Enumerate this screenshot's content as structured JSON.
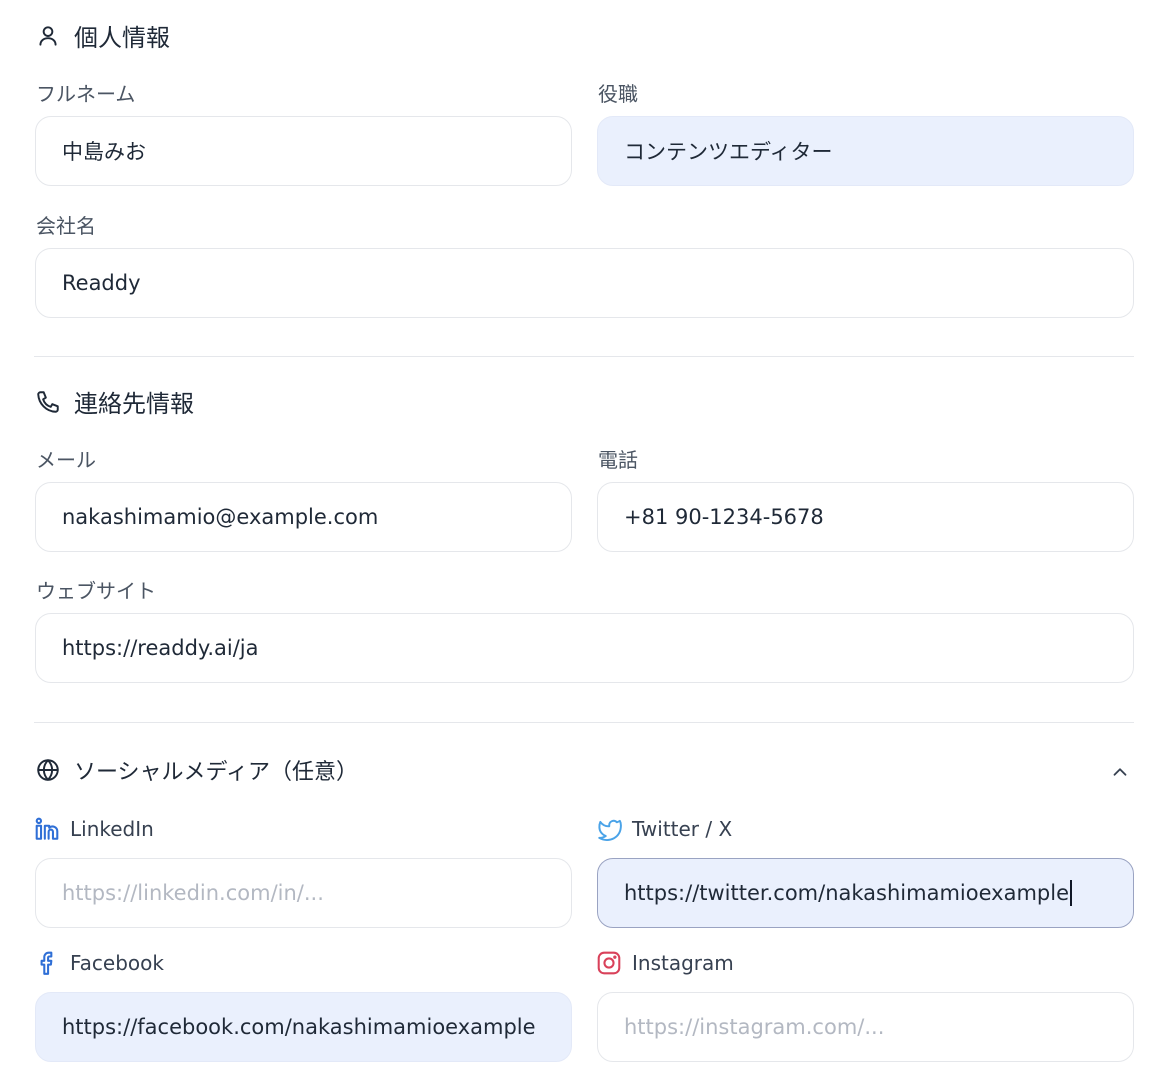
{
  "personal": {
    "title": "個人情報",
    "icon": "user-icon",
    "full_name": {
      "label": "フルネーム",
      "value": "中島みお"
    },
    "job_title": {
      "label": "役職",
      "value": "コンテンツエディター"
    },
    "company": {
      "label": "会社名",
      "value": "Readdy"
    }
  },
  "contact": {
    "title": "連絡先情報",
    "icon": "phone-icon",
    "email": {
      "label": "メール",
      "value": "nakashimamio@example.com"
    },
    "phone": {
      "label": "電話",
      "value": "+81 90-1234-5678"
    },
    "website": {
      "label": "ウェブサイト",
      "value": "https://readdy.ai/ja"
    }
  },
  "social": {
    "title": "ソーシャルメディア（任意）",
    "icon": "globe-icon",
    "collapse_icon": "chevron-up-icon",
    "linkedin": {
      "label": "LinkedIn",
      "placeholder": "https://linkedin.com/in/...",
      "value": "",
      "icon": "linkedin-icon",
      "color": "#2f6fd6"
    },
    "twitter": {
      "label": "Twitter / X",
      "value": "https://twitter.com/nakashimamioexample",
      "icon": "twitter-icon",
      "color": "#4aa3e8"
    },
    "facebook": {
      "label": "Facebook",
      "value": "https://facebook.com/nakashimamioexample",
      "icon": "facebook-icon",
      "color": "#2f6fd6"
    },
    "instagram": {
      "label": "Instagram",
      "placeholder": "https://instagram.com/...",
      "value": "",
      "icon": "instagram-icon",
      "color": "#d9415a"
    }
  },
  "colors": {
    "filled_bg": "#eaf0fd",
    "border": "#e5e7eb",
    "focus_border": "#9aa3c2"
  }
}
